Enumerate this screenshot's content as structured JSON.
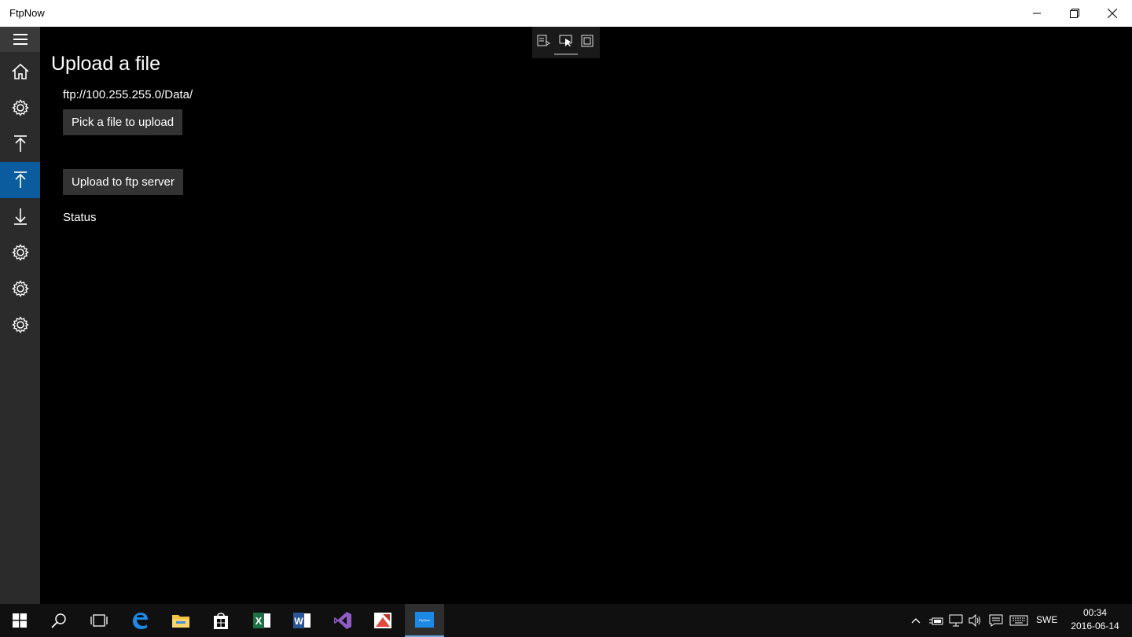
{
  "window": {
    "title": "FtpNow"
  },
  "page": {
    "title": "Upload a file",
    "path": "ftp://100.255.255.0/Data/",
    "pick_button": "Pick a file to upload",
    "upload_button": "Upload to ftp server",
    "status": "Status"
  },
  "nav": {
    "items": [
      "menu-icon",
      "home-icon",
      "gear-icon",
      "upload-icon",
      "upload-icon",
      "download-icon",
      "gear-icon",
      "gear-icon",
      "gear-icon"
    ],
    "active_index": 4,
    "accent": "#0a5c9e"
  },
  "taskbar": {
    "lang": "SWE",
    "time": "00:34",
    "date": "2016-06-14",
    "active_app_label": "FtpNow"
  }
}
